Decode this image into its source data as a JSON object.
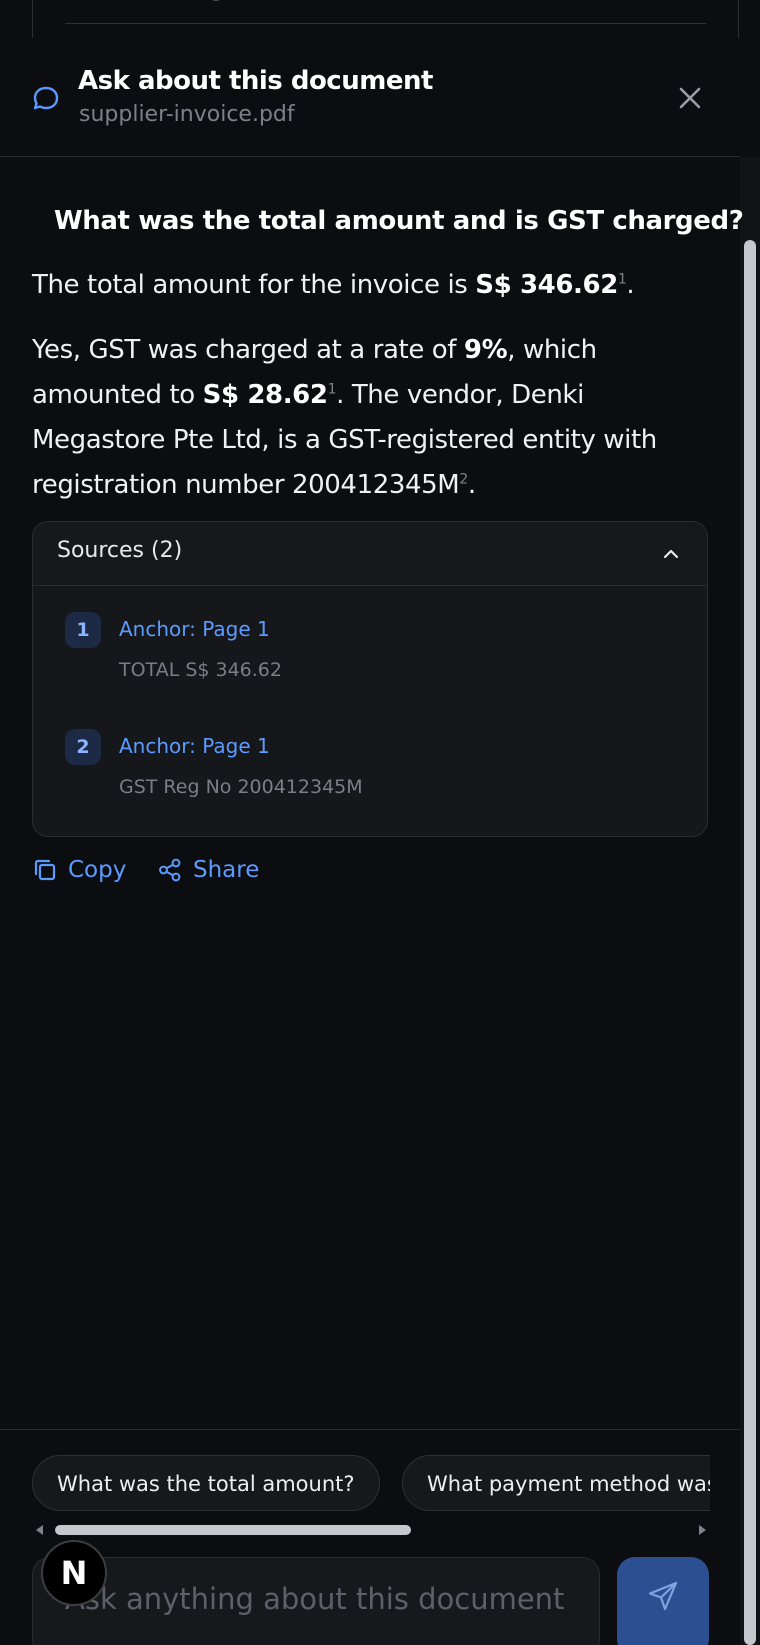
{
  "header": {
    "title": "Ask about this document",
    "subtitle": "supplier-invoice.pdf"
  },
  "conversation": {
    "question": "What was the total amount and is GST charged?",
    "answer": {
      "p1_prefix": "The total amount for the invoice is ",
      "p1_amount": "S$ 346.62",
      "p1_cite": "1",
      "p1_suffix": ".",
      "p2_l1_prefix": "Yes, GST was charged at a rate of ",
      "p2_l1_rate": "9%",
      "p2_l1_suffix": ", which",
      "p2_l2_prefix": "amounted to ",
      "p2_l2_amount": "S$ 28.62",
      "p2_l2_cite": "1",
      "p2_l2_suffix": ". The vendor, Denki",
      "p2_l3": "Megastore Pte Ltd, is a GST-registered entity with",
      "p2_l4_prefix": "registration number 200412345M",
      "p2_l4_cite": "2",
      "p2_l4_suffix": "."
    }
  },
  "sources": {
    "title": "Sources (2)",
    "items": [
      {
        "num": "1",
        "anchor": "Anchor: Page 1",
        "text": "TOTAL S$ 346.62"
      },
      {
        "num": "2",
        "anchor": "Anchor: Page 1",
        "text": "GST Reg No 200412345M"
      }
    ]
  },
  "actions": {
    "copy": "Copy",
    "share": "Share"
  },
  "suggestions": [
    "What was the total amount?",
    "What payment method was"
  ],
  "input": {
    "placeholder": "Ask anything about this document"
  },
  "badge": "N",
  "colors": {
    "background": "#0c0d10",
    "accent": "#5b9bff",
    "send_button": "#2c4f92"
  }
}
